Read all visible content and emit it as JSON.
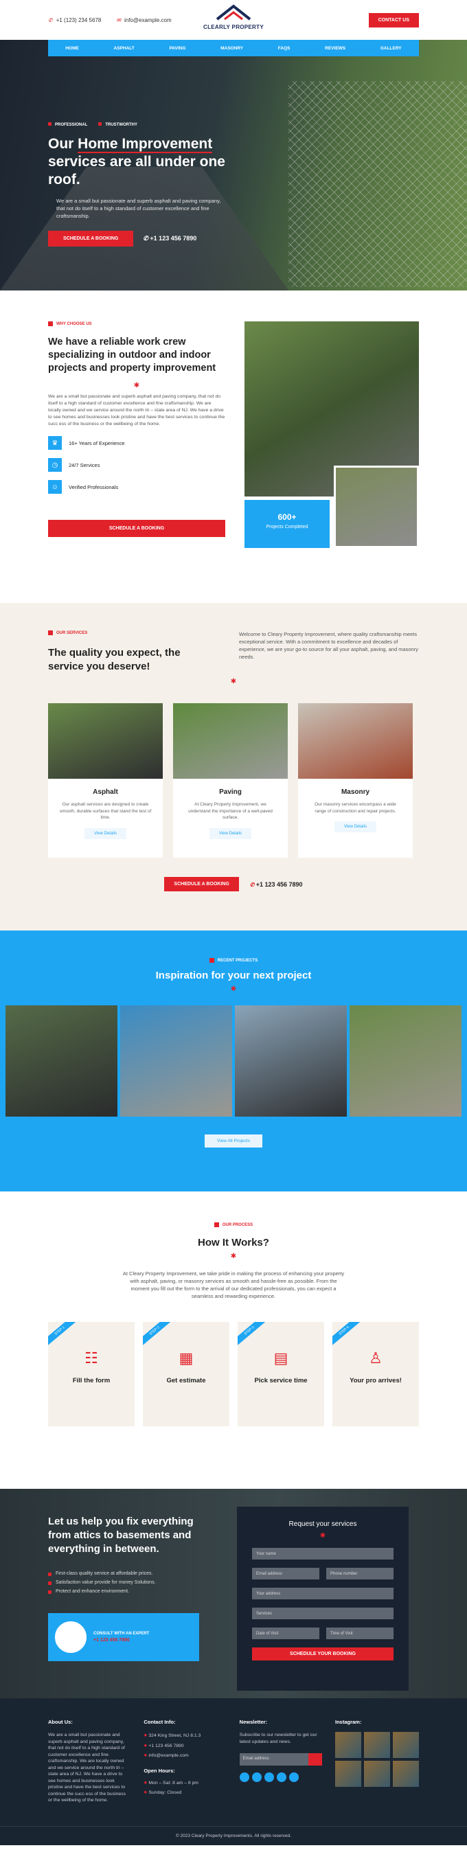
{
  "header": {
    "phone": "+1 (123) 234 5678",
    "email": "info@example.com",
    "logo_text": "CLEARLY PROPERTY",
    "cta": "CONTACT US"
  },
  "nav": [
    "HOME",
    "ASPHALT",
    "PAVING",
    "MASONRY",
    "FAQS",
    "REVIEWS",
    "GALLERY"
  ],
  "hero": {
    "tags": [
      "PROFESSIONAL",
      "TRUSTWORTHY"
    ],
    "title_a": "Our ",
    "title_u": "Home Improvement",
    "title_b": " services are all under one roof.",
    "desc": "We are a small but passionate and superb asphalt and paving company, that not do itself to a high standard of customer excellence and fine craftsmanship.",
    "button": "SCHEDULE A BOOKING",
    "phone": "+1 123 456 7890"
  },
  "why": {
    "eyebrow": "WHY CHOOSE US",
    "title": "We have a reliable work crew specializing in outdoor and indoor projects and property improvement",
    "desc": "We are a small but passionate and superb asphalt and paving company, that not do itself to a high standard of customer excellence and fine craftsmanship. We are locally owned and we service around the north tri – state area of NJ. We have a drive to see homes and businesses look pristine and have the best services to continue the succ ess of the business or the wellbeing of the home.",
    "features": [
      "16+ Years of Experience",
      "24/7 Services",
      "Verified Professionals"
    ],
    "button": "SCHEDULE A BOOKING",
    "stat_num": "600+",
    "stat_label": "Projects Completed"
  },
  "services": {
    "eyebrow": "OUR SERVICES",
    "title": "The quality you expect, the service you deserve!",
    "desc": "Welcome to Cleary Property Improvement, where quality craftsmanship meets exceptional service. With a commitment to excellence and decades of experience, we are your go-to source for all your asphalt, paving, and masonry needs.",
    "cards": [
      {
        "title": "Asphalt",
        "desc": "Our asphalt services are designed to create smooth, durable surfaces that stand the test of time.",
        "btn": "View Details"
      },
      {
        "title": "Paving",
        "desc": "At Cleary Property Improvement, we understand the importance of a well-paved surface.",
        "btn": "View Details"
      },
      {
        "title": "Masonry",
        "desc": "Our masonry services encompass a wide range of construction and repair projects.",
        "btn": "View Details"
      }
    ],
    "button": "SCHEDULE A BOOKING",
    "phone": "+1 123 456 7890"
  },
  "recent": {
    "eyebrow": "RECENT PROJECTS",
    "title": "Inspiration for your next project",
    "button": "View All Projects"
  },
  "how": {
    "eyebrow": "OUR PROCESS",
    "title": "How It Works?",
    "desc": "At Cleary Property Improvement, we take pride in making the process of enhancing your property with asphalt, paving, or masonry services as smooth and hassle-free as possible. From the moment you fill out the form to the arrival of our dedicated professionals, you can expect a seamless and rewarding experience.",
    "steps": [
      {
        "n": "STEP 1",
        "t": "Fill the form"
      },
      {
        "n": "STEP 2",
        "t": "Get estimate"
      },
      {
        "n": "STEP 3",
        "t": "Pick service time"
      },
      {
        "n": "STEP 4",
        "t": "Your pro arrives!"
      }
    ]
  },
  "request": {
    "title": "Let us help you fix everything from attics to basements and everything in between.",
    "bullets": [
      "First-class quality service at affordable prices.",
      "Satisfaction value provide for money Solutions.",
      "Protect and enhance environment."
    ],
    "expert_label": "CONSULT WITH AN EXPERT",
    "expert_phone": "+1 123 456 7890",
    "form_title": "Request your services",
    "fields": {
      "name": "Your name",
      "email": "Email address",
      "phone": "Phone number",
      "address": "Your address",
      "services": "Services",
      "date": "Date of Visit",
      "time": "Time of Visit"
    },
    "form_button": "SCHEDULE YOUR BOOKING"
  },
  "footer": {
    "about_title": "About Us:",
    "about": "We are a small but passionate and superb asphalt and paving company, that not do itself to a high standard of customer excellence and fine craftsmanship. We are locally owned and we service around the north tri – state area of NJ. We have a drive to see homes and businesses look pristine and have the best services to continue the succ ess of the business or the wellbeing of the home.",
    "contact_title": "Contact Info:",
    "address": "324 King Street, NJ 8.1.3",
    "phone": "+1 123 456 7890",
    "email": "info@example.com",
    "hours_title": "Open Hours:",
    "hours1": "Mon – Sat: 8 am – 8 pm",
    "hours2": "Sunday: Closed",
    "news_title": "Newsletter:",
    "news_desc": "Subscribe to our newsletter to get our latest updates and news.",
    "news_placeholder": "Email address",
    "insta_title": "Instagram:",
    "copyright": "© 2023 Cleary Property Improvements. All rights reserved."
  }
}
